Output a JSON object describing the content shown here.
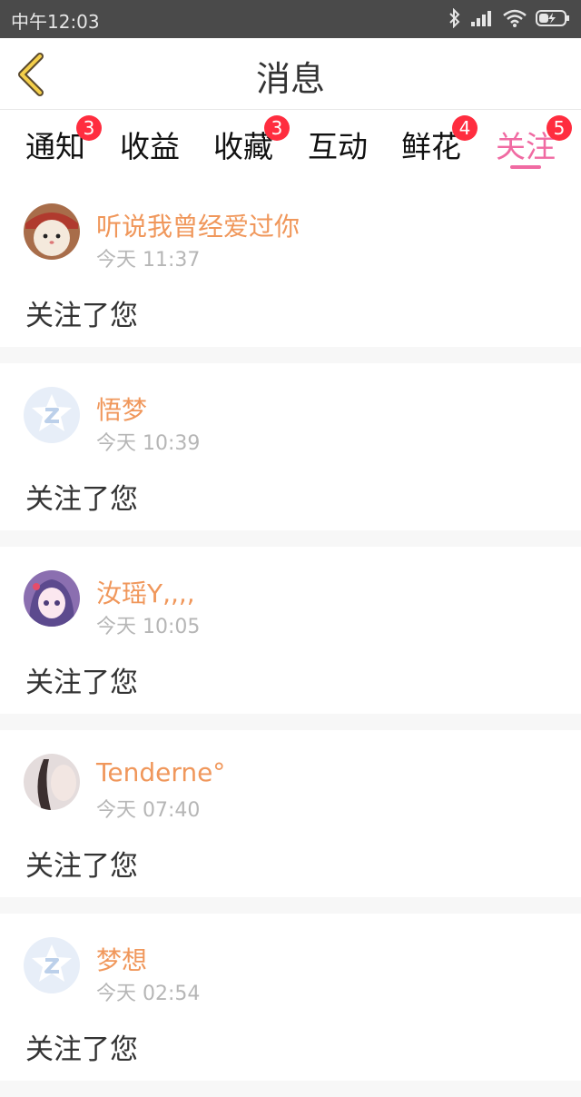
{
  "status_bar": {
    "time": "中午12:03",
    "icons": [
      "bluetooth-icon",
      "signal-icon",
      "wifi-icon",
      "battery-icon"
    ]
  },
  "header": {
    "title": "消息"
  },
  "tabs": [
    {
      "label": "通知",
      "badge": "3"
    },
    {
      "label": "收益",
      "badge": ""
    },
    {
      "label": "收藏",
      "badge": "3"
    },
    {
      "label": "互动",
      "badge": ""
    },
    {
      "label": "鲜花",
      "badge": "4"
    },
    {
      "label": "关注",
      "badge": "5",
      "active": true
    }
  ],
  "colors": {
    "accent": "#f06aa2",
    "username": "#f0975b",
    "badge": "#ff2d3f"
  },
  "feed": [
    {
      "name": "听说我曾经爱过你",
      "time": "今天 11:37",
      "text": "关注了您",
      "avatar": "cat-photo"
    },
    {
      "name": "悟梦",
      "time": "今天 10:39",
      "text": "关注了您",
      "avatar": "default-z-logo"
    },
    {
      "name": "汝瑶Y,,,,",
      "time": "今天 10:05",
      "text": "关注了您",
      "avatar": "anime-girl"
    },
    {
      "name": "Tenderne°",
      "time": "今天 07:40",
      "text": "关注了您",
      "avatar": "portrait-photo"
    },
    {
      "name": "梦想",
      "time": "今天 02:54",
      "text": "关注了您",
      "avatar": "default-z-logo"
    }
  ]
}
